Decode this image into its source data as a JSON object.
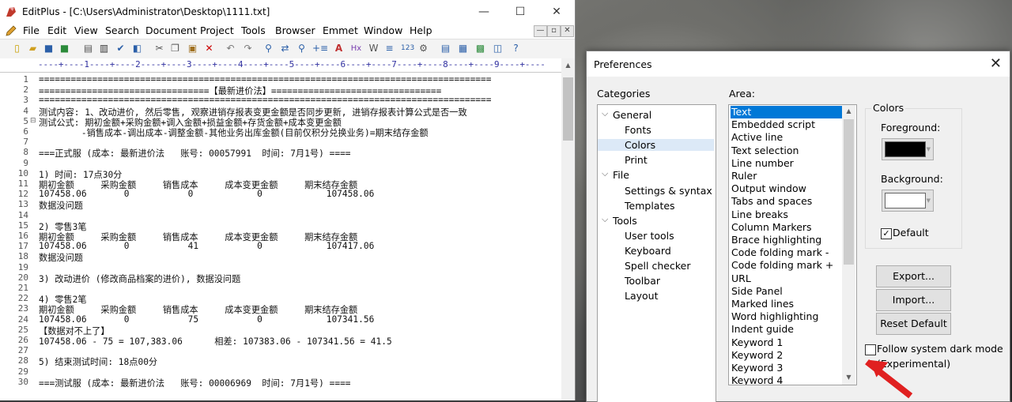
{
  "editplus": {
    "title": "EditPlus - [C:\\Users\\Administrator\\Desktop\\1111.txt]",
    "window_buttons": [
      "—",
      "☐",
      "✕"
    ],
    "menu": [
      "File",
      "Edit",
      "View",
      "Search",
      "Document",
      "Project",
      "Tools",
      "Browser",
      "Emmet",
      "Window",
      "Help"
    ],
    "mdi_buttons": [
      "—",
      "▫",
      "✕"
    ],
    "ruler": "----+----1----+----2----+----3----+----4----+----5----+----6----+----7----+----8----+----9----+----",
    "lines": [
      {
        "n": "1",
        "t": "====================================================================================="
      },
      {
        "n": "2",
        "t": "================================【最新进价法】================================"
      },
      {
        "n": "3",
        "t": "====================================================================================="
      },
      {
        "n": "4",
        "t": "测试内容: 1、改动进价, 然后零售, 观察进销存报表变更金额是否同步更新, 进销存报表计算公式是否一致"
      },
      {
        "n": "5",
        "t": "测试公式: 期初金额+采购金额+调入金额+损益金额+存货金额+成本变更金额"
      },
      {
        "n": "6",
        "t": "        -销售成本-调出成本-调整金额-其他业务出库金额(目前仅积分兑换业务)=期末结存金额"
      },
      {
        "n": "7",
        "t": ""
      },
      {
        "n": "8",
        "t": "===正式服 (成本: 最新进价法   账号: 00057991  时间: 7月1号) ===="
      },
      {
        "n": "9",
        "t": ""
      },
      {
        "n": "10",
        "t": "1) 时间: 17点30分"
      },
      {
        "n": "11",
        "t": "期初金额     采购金额     销售成本     成本变更金额     期末结存金额"
      },
      {
        "n": "12",
        "t": "107458.06       0           0            0            107458.06"
      },
      {
        "n": "13",
        "t": "数据没问题"
      },
      {
        "n": "14",
        "t": ""
      },
      {
        "n": "15",
        "t": "2) 零售3笔"
      },
      {
        "n": "16",
        "t": "期初金额     采购金额     销售成本     成本变更金额     期末结存金额"
      },
      {
        "n": "17",
        "t": "107458.06       0           41           0            107417.06"
      },
      {
        "n": "18",
        "t": "数据没问题"
      },
      {
        "n": "19",
        "t": ""
      },
      {
        "n": "20",
        "t": "3) 改动进价 (修改商品档案的进价), 数据没问题"
      },
      {
        "n": "21",
        "t": ""
      },
      {
        "n": "22",
        "t": "4) 零售2笔"
      },
      {
        "n": "23",
        "t": "期初金额     采购金额     销售成本     成本变更金额     期末结存金额"
      },
      {
        "n": "24",
        "t": "107458.06       0           75           0            107341.56"
      },
      {
        "n": "25",
        "t": "【数据对不上了】"
      },
      {
        "n": "26",
        "t": "107458.06 - 75 = 107,383.06      相差: 107383.06 - 107341.56 = 41.5"
      },
      {
        "n": "27",
        "t": ""
      },
      {
        "n": "28",
        "t": "5) 结束测试时间: 18点00分"
      },
      {
        "n": "29",
        "t": ""
      },
      {
        "n": "30",
        "t": "===测试服 (成本: 最新进价法   账号: 00006969  时间: 7月1号) ===="
      }
    ]
  },
  "prefs": {
    "title": "Preferences",
    "close": "✕",
    "categories_label": "Categories",
    "area_label": "Area:",
    "categories": [
      {
        "label": "General",
        "level": 0,
        "expanded": true
      },
      {
        "label": "Fonts",
        "level": 1
      },
      {
        "label": "Colors",
        "level": 1,
        "selected": true
      },
      {
        "label": "Print",
        "level": 1
      },
      {
        "label": "File",
        "level": 0,
        "expanded": true
      },
      {
        "label": "Settings & syntax",
        "level": 1
      },
      {
        "label": "Templates",
        "level": 1
      },
      {
        "label": "Tools",
        "level": 0,
        "expanded": true
      },
      {
        "label": "User tools",
        "level": 1
      },
      {
        "label": "Keyboard",
        "level": 1
      },
      {
        "label": "Spell checker",
        "level": 1
      },
      {
        "label": "Toolbar",
        "level": 1
      },
      {
        "label": "Layout",
        "level": 1
      }
    ],
    "area_items": [
      "Text",
      "Embedded script",
      "Active line",
      "Text selection",
      "Line number",
      "Ruler",
      "Output window",
      "Tabs and spaces",
      "Line breaks",
      "Column Markers",
      "Brace highlighting",
      "Code folding mark -",
      "Code folding mark +",
      "URL",
      "Side Panel",
      "Marked lines",
      "Word highlighting",
      "Indent guide",
      "Keyword 1",
      "Keyword 2",
      "Keyword 3",
      "Keyword 4"
    ],
    "area_selected": "Text",
    "colors_group": "Colors",
    "foreground_label": "Foreground:",
    "foreground_color": "#000000",
    "background_label": "Background:",
    "background_color": "#ffffff",
    "default_label": "Default",
    "default_checked": true,
    "export_label": "Export...",
    "import_label": "Import...",
    "reset_label": "Reset Default",
    "dark_mode_label": "Follow system dark mode",
    "dark_mode_sub": "(Experimental)",
    "dark_mode_checked": false
  }
}
